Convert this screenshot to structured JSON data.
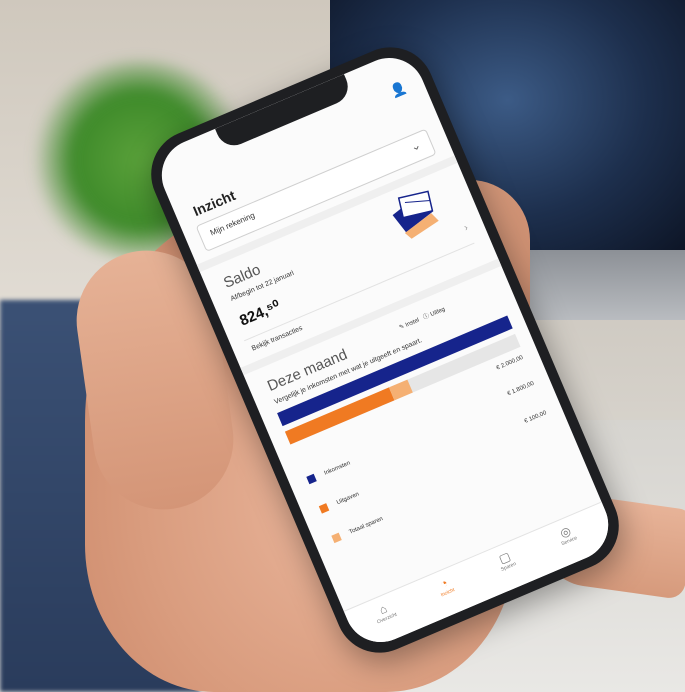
{
  "app": {
    "title": "Inzicht",
    "dropdown_value": "Mijn rekening",
    "dropdown_chevron": "⌄",
    "profile_icon": "person-icon"
  },
  "saldo": {
    "title": "Saldo",
    "subtitle": "Af/begin tot 22 januari",
    "amount": "824,⁵⁰",
    "link": "Bekijk transacties"
  },
  "month": {
    "title": "Deze maand",
    "edit_link": "✎ Instel",
    "info_link": "ⓘ Uitleg",
    "subtitle": "Vergelijk je inkomsten met wat je uitgeeft en spaart.",
    "inkomsten_fill": 1.0,
    "uitgaven_fill": 0.45,
    "sparen_fill": 0.08,
    "total": "€ 2.000,00",
    "legend": [
      {
        "label": "Inkomsten",
        "amount": "€ 1.800,00",
        "color": "#16248c"
      },
      {
        "label": "Uitgaven",
        "amount": "€ 100,00",
        "color": "#f07a22"
      },
      {
        "label": "Totaal sparen",
        "amount": "",
        "color": "#f5b073"
      }
    ]
  },
  "nav": [
    {
      "label": "Overzicht",
      "icon": "home-icon",
      "glyph": "⌂"
    },
    {
      "label": "Inzicht",
      "icon": "insight-icon",
      "glyph": "◔"
    },
    {
      "label": "Sparen",
      "icon": "savings-icon",
      "glyph": "▢"
    },
    {
      "label": "Service",
      "icon": "service-icon",
      "glyph": "◎"
    }
  ],
  "colors": {
    "primary_blue": "#16248c",
    "accent_orange": "#f07a22"
  }
}
